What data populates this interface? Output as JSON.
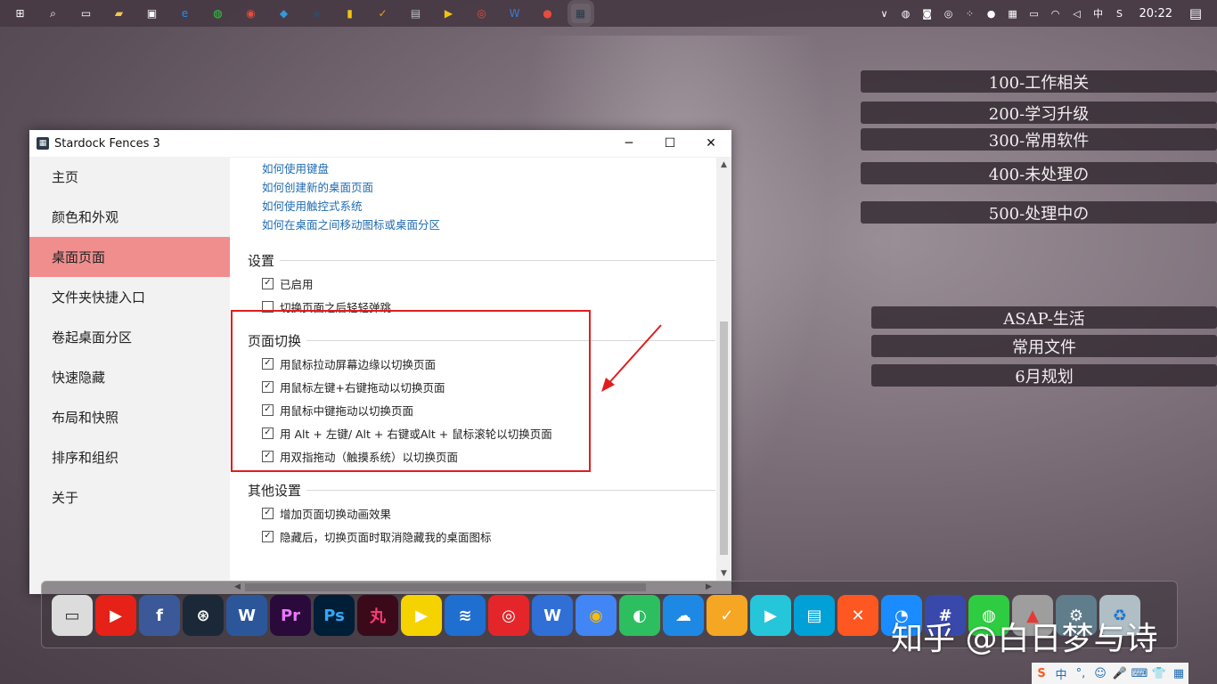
{
  "taskbar": {
    "pinned": [
      {
        "name": "windows-icon",
        "glyph": "⊞",
        "color": "#ffffff"
      },
      {
        "name": "search-icon",
        "glyph": "⌕",
        "color": "#ffffff"
      },
      {
        "name": "task-view-icon",
        "glyph": "▭",
        "color": "#ffffff"
      },
      {
        "name": "file-explorer-icon",
        "glyph": "▰",
        "color": "#f2c94c"
      },
      {
        "name": "store-icon",
        "glyph": "▣",
        "color": "#ffffff"
      },
      {
        "name": "edge-icon",
        "glyph": "e",
        "color": "#2b8ae6"
      },
      {
        "name": "wechat-icon",
        "glyph": "◍",
        "color": "#2ecc40"
      },
      {
        "name": "chrome-icon",
        "glyph": "◉",
        "color": "#e74c3c"
      },
      {
        "name": "app-blue-icon",
        "glyph": "◆",
        "color": "#3498db"
      },
      {
        "name": "app-dark-icon",
        "glyph": "▪",
        "color": "#34495e"
      },
      {
        "name": "sticky-notes-icon",
        "glyph": "▮",
        "color": "#f1c40f"
      },
      {
        "name": "todo-icon",
        "glyph": "✓",
        "color": "#f39c12"
      },
      {
        "name": "notepad-icon",
        "glyph": "▤",
        "color": "#bdc3c7"
      },
      {
        "name": "player-icon",
        "glyph": "▶",
        "color": "#f1c40f"
      },
      {
        "name": "netease-music-icon",
        "glyph": "◎",
        "color": "#e74c3c"
      },
      {
        "name": "wps-icon",
        "glyph": "W",
        "color": "#3a7bd5"
      },
      {
        "name": "record-icon",
        "glyph": "●",
        "color": "#e74c3c"
      },
      {
        "name": "fences-icon",
        "glyph": "▦",
        "color": "#2b3a4a"
      }
    ],
    "tray": [
      {
        "name": "chevron-up-icon",
        "glyph": "∨"
      },
      {
        "name": "wechat-tray-icon",
        "glyph": "◍"
      },
      {
        "name": "tray-app-icon",
        "glyph": "◙"
      },
      {
        "name": "netease-tray-icon",
        "glyph": "◎"
      },
      {
        "name": "tray-dots-icon",
        "glyph": "⁘"
      },
      {
        "name": "tray-green-icon",
        "glyph": "●"
      },
      {
        "name": "tray-grid-icon",
        "glyph": "▦"
      },
      {
        "name": "battery-icon",
        "glyph": "▭"
      },
      {
        "name": "wifi-icon",
        "glyph": "◠"
      },
      {
        "name": "volume-icon",
        "glyph": "◁"
      },
      {
        "name": "ime-lang-icon",
        "glyph": "中"
      },
      {
        "name": "sogou-icon",
        "glyph": "S"
      }
    ],
    "clock": "20:22",
    "notification_icon": "▤"
  },
  "fences": [
    {
      "label": "100-工作相关"
    },
    {
      "label": "200-学习升级"
    },
    {
      "label": "300-常用软件"
    },
    {
      "label": "400-未处理の"
    },
    {
      "label": "500-处理中の"
    },
    {
      "label": "ASAP-生活"
    },
    {
      "label": "常用文件"
    },
    {
      "label": "6月规划"
    }
  ],
  "window": {
    "title": "Stardock Fences 3",
    "minimize": "─",
    "maximize": "☐",
    "close": "✕",
    "sidebar": [
      "主页",
      "颜色和外观",
      "桌面页面",
      "文件夹快捷入口",
      "卷起桌面分区",
      "快速隐藏",
      "布局和快照",
      "排序和组织",
      "关于"
    ],
    "links": [
      "如何使用键盘",
      "如何创建新的桌面页面",
      "如何使用触控式系统",
      "如何在桌面之间移动图标或桌面分区"
    ],
    "sections": {
      "settings": {
        "title": "设置",
        "options": [
          {
            "label": "已启用",
            "checked": true
          },
          {
            "label": "切换页面之后轻轻弹跳",
            "checked": false
          }
        ]
      },
      "page_switch": {
        "title": "页面切换",
        "options": [
          {
            "label": "用鼠标拉动屏幕边缘以切换页面",
            "checked": true
          },
          {
            "label": "用鼠标左键+右键拖动以切换页面",
            "checked": true
          },
          {
            "label": "用鼠标中键拖动以切换页面",
            "checked": true
          },
          {
            "label": "用 Alt + 左键/ Alt + 右键或Alt + 鼠标滚轮以切换页面",
            "checked": true
          },
          {
            "label": "用双指拖动（触摸系统）以切换页面",
            "checked": true
          }
        ]
      },
      "other": {
        "title": "其他设置",
        "options": [
          {
            "label": "增加页面切换动画效果",
            "checked": true
          },
          {
            "label": "隐藏后，切换页面时取消隐藏我的桌面图标",
            "checked": true
          }
        ]
      }
    }
  },
  "dock": [
    {
      "name": "computer-icon",
      "glyph": "▭",
      "bg": "#dcdcdc",
      "fg": "#333333"
    },
    {
      "name": "youtube-icon",
      "glyph": "▶",
      "bg": "#e62117",
      "fg": "#ffffff"
    },
    {
      "name": "facebook-icon",
      "glyph": "f",
      "bg": "#3b5998",
      "fg": "#ffffff"
    },
    {
      "name": "steam-icon",
      "glyph": "⊛",
      "bg": "#1b2838",
      "fg": "#ffffff"
    },
    {
      "name": "word-icon",
      "glyph": "W",
      "bg": "#2b579a",
      "fg": "#ffffff"
    },
    {
      "name": "premiere-icon",
      "glyph": "Pr",
      "bg": "#2a0a3a",
      "fg": "#ea77ff"
    },
    {
      "name": "photoshop-icon",
      "glyph": "Ps",
      "bg": "#001e36",
      "fg": "#31a8ff"
    },
    {
      "name": "wan-icon",
      "glyph": "丸",
      "bg": "#3a0a1a",
      "fg": "#ff3a7a"
    },
    {
      "name": "player-dock-icon",
      "glyph": "▶",
      "bg": "#f5d300",
      "fg": "#ffffff"
    },
    {
      "name": "router-icon",
      "glyph": "≋",
      "bg": "#1f6fd1",
      "fg": "#ffffff"
    },
    {
      "name": "netease-dock-icon",
      "glyph": "◎",
      "bg": "#e4262b",
      "fg": "#ffffff"
    },
    {
      "name": "wps-dock-icon",
      "glyph": "W",
      "bg": "#2f6fd6",
      "fg": "#ffffff"
    },
    {
      "name": "chrome-dock-icon",
      "glyph": "◉",
      "bg": "#4285f4",
      "fg": "#fbbc05"
    },
    {
      "name": "evernote-icon",
      "glyph": "◐",
      "bg": "#2dbe60",
      "fg": "#ffffff"
    },
    {
      "name": "cloud-icon",
      "glyph": "☁",
      "bg": "#1e88e5",
      "fg": "#ffffff"
    },
    {
      "name": "todo-dock-icon",
      "glyph": "✓",
      "bg": "#f5a623",
      "fg": "#ffffff"
    },
    {
      "name": "video-icon",
      "glyph": "▶",
      "bg": "#26c6da",
      "fg": "#ffffff"
    },
    {
      "name": "bilibili-icon",
      "glyph": "▤",
      "bg": "#00a1d6",
      "fg": "#ffffff"
    },
    {
      "name": "xmind-icon",
      "glyph": "✕",
      "bg": "#ff5722",
      "fg": "#ffffff"
    },
    {
      "name": "browser-icon",
      "glyph": "◔",
      "bg": "#1a8cff",
      "fg": "#ffffff"
    },
    {
      "name": "hash-icon",
      "glyph": "#",
      "bg": "#3949ab",
      "fg": "#ffffff"
    },
    {
      "name": "wechat-dock-icon",
      "glyph": "◍",
      "bg": "#2ecc40",
      "fg": "#ffffff"
    },
    {
      "name": "rocket-icon",
      "glyph": "▲",
      "bg": "#9e9e9e",
      "fg": "#e53935"
    },
    {
      "name": "settings-dock-icon",
      "glyph": "⚙",
      "bg": "#607d8b",
      "fg": "#ffffff"
    },
    {
      "name": "recycle-bin-icon",
      "glyph": "♻",
      "bg": "#b0bec5",
      "fg": "#1976d2"
    }
  ],
  "watermark": "知乎 @白日梦与诗",
  "ime_bar": [
    "S",
    "中",
    "°,",
    "☺",
    "🎤",
    "⌨",
    "👕",
    "▦"
  ],
  "colors": {
    "accent_selected": "#f08e8e",
    "link": "#1f6bb0",
    "highlight": "#e01e1e"
  }
}
